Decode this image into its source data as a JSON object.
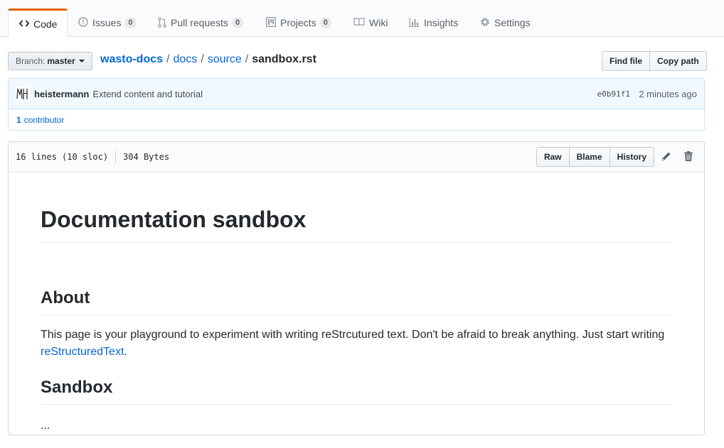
{
  "tabs": [
    {
      "label": "Code",
      "icon": "code-icon",
      "selected": true
    },
    {
      "label": "Issues",
      "icon": "issue-icon",
      "count": "0"
    },
    {
      "label": "Pull requests",
      "icon": "pull-request-icon",
      "count": "0"
    },
    {
      "label": "Projects",
      "icon": "project-icon",
      "count": "0"
    },
    {
      "label": "Wiki",
      "icon": "book-icon"
    },
    {
      "label": "Insights",
      "icon": "graph-icon"
    },
    {
      "label": "Settings",
      "icon": "gear-icon"
    }
  ],
  "branch": {
    "prefix": "Branch:",
    "name": "master"
  },
  "breadcrumb": {
    "root": "wasto-docs",
    "parts": [
      "docs",
      "source"
    ],
    "file": "sandbox.rst",
    "separator": "/"
  },
  "file_nav": {
    "find_file": "Find file",
    "copy_path": "Copy path"
  },
  "commit": {
    "author": "heistermann",
    "message": "Extend content and tutorial",
    "sha": "e0b91f1",
    "time": "2 minutes ago",
    "contributors_count": "1",
    "contributors_label": "contributor"
  },
  "file": {
    "lines": "16 lines (10 sloc)",
    "size": "304 Bytes",
    "actions": {
      "raw": "Raw",
      "blame": "Blame",
      "history": "History"
    },
    "edit_icon": "pencil-icon",
    "delete_icon": "trashcan-icon"
  },
  "content": {
    "h1": "Documentation sandbox",
    "h2_about": "About",
    "para_text": "This page is your playground to experiment with writing reStrcutured text. Don't be afraid to break anything. Just start writing ",
    "para_link": "reStructuredText",
    "para_end": ".",
    "h2_sandbox": "Sandbox",
    "ellipsis": "..."
  },
  "colors": {
    "accent": "#e36209",
    "link": "#0366d6",
    "commit_bg": "#f1f8ff"
  }
}
